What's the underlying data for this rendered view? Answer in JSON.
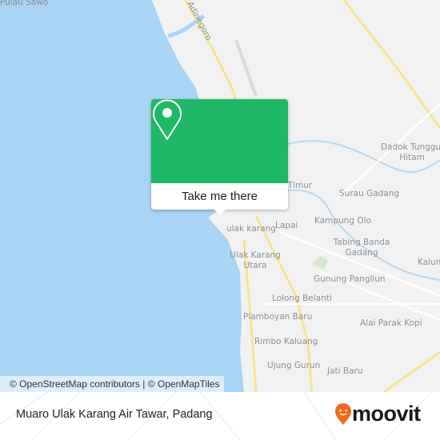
{
  "map": {
    "labels": [
      "Pulau Sawo",
      "Adinegoro",
      "Dadok Tunggul Hitam",
      "Surau Gadang",
      "Timur",
      "Kampung Olo",
      "Lapai",
      "ulak karang",
      "Ulak Karang Utara",
      "Tabing Banda Gadang",
      "Gunung Pangilun",
      "Kalum",
      "Lolong Belanti",
      "Plamboyan Baru",
      "Alai Parak Kopi",
      "Rimbo Kaluang",
      "Ujung Gurun",
      "Jati Baru"
    ],
    "water_color": "#a8d4f5",
    "land_color": "#f2f2f2",
    "road_color": "#f7e58f"
  },
  "popup": {
    "icon": "map-pin-icon",
    "button_label": "Take me there",
    "color": "#1fb866"
  },
  "attribution": "© OpenStreetMap contributors | © OpenMapTiles",
  "footer": {
    "title": "Muaro Ulak Karang Air Tawar, Padang",
    "logo": "moovit",
    "logo_color": "#f26b1d"
  }
}
